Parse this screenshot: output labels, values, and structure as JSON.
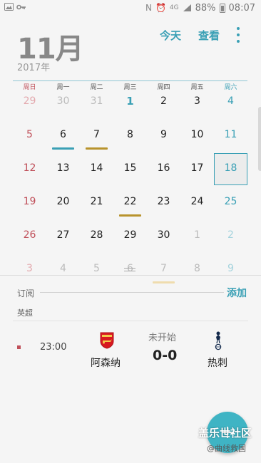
{
  "status_bar": {
    "left_icons": [
      "photo-icon",
      "key-icon"
    ],
    "network": "4G",
    "battery": "88%",
    "time": "08:07"
  },
  "header": {
    "month": "11月",
    "year": "2017年",
    "today_label": "今天",
    "view_label": "查看"
  },
  "calendar": {
    "weekdays": [
      "周日",
      "周一",
      "周二",
      "周三",
      "周四",
      "周五",
      "周六"
    ],
    "weeks": [
      [
        {
          "d": "29",
          "o": true
        },
        {
          "d": "30",
          "o": true
        },
        {
          "d": "31",
          "o": true
        },
        {
          "d": "1",
          "today": true
        },
        {
          "d": "2"
        },
        {
          "d": "3"
        },
        {
          "d": "4"
        }
      ],
      [
        {
          "d": "5"
        },
        {
          "d": "6",
          "bar": "#3aa0b5"
        },
        {
          "d": "7",
          "bar": "#b8932c"
        },
        {
          "d": "8"
        },
        {
          "d": "9"
        },
        {
          "d": "10"
        },
        {
          "d": "11"
        }
      ],
      [
        {
          "d": "12"
        },
        {
          "d": "13"
        },
        {
          "d": "14"
        },
        {
          "d": "15"
        },
        {
          "d": "16"
        },
        {
          "d": "17"
        },
        {
          "d": "18",
          "selected": true
        }
      ],
      [
        {
          "d": "19"
        },
        {
          "d": "20"
        },
        {
          "d": "21"
        },
        {
          "d": "22",
          "bar": "#b8932c"
        },
        {
          "d": "23"
        },
        {
          "d": "24"
        },
        {
          "d": "25"
        }
      ],
      [
        {
          "d": "26"
        },
        {
          "d": "27"
        },
        {
          "d": "28"
        },
        {
          "d": "29"
        },
        {
          "d": "30"
        },
        {
          "d": "1",
          "o": true
        },
        {
          "d": "2",
          "o": true
        }
      ],
      [
        {
          "d": "3",
          "o": true
        },
        {
          "d": "4",
          "o": true
        },
        {
          "d": "5",
          "o": true
        },
        {
          "d": "6",
          "o": true
        },
        {
          "d": "7",
          "o": true,
          "bar": "#efdcae"
        },
        {
          "d": "8",
          "o": true
        },
        {
          "d": "9",
          "o": true
        }
      ]
    ]
  },
  "subscriptions": {
    "label": "订阅",
    "add_label": "添加",
    "league": "英超"
  },
  "match": {
    "time": "23:00",
    "home_team": "阿森纳",
    "away_team": "热刺",
    "status": "未开始",
    "score": "0-0"
  },
  "watermark": {
    "main": "盖乐世社区",
    "sub": "@曲线救国"
  },
  "colors": {
    "accent": "#3aa0b5",
    "sunday": "#c0505a",
    "fab": "#3fb4c4"
  }
}
